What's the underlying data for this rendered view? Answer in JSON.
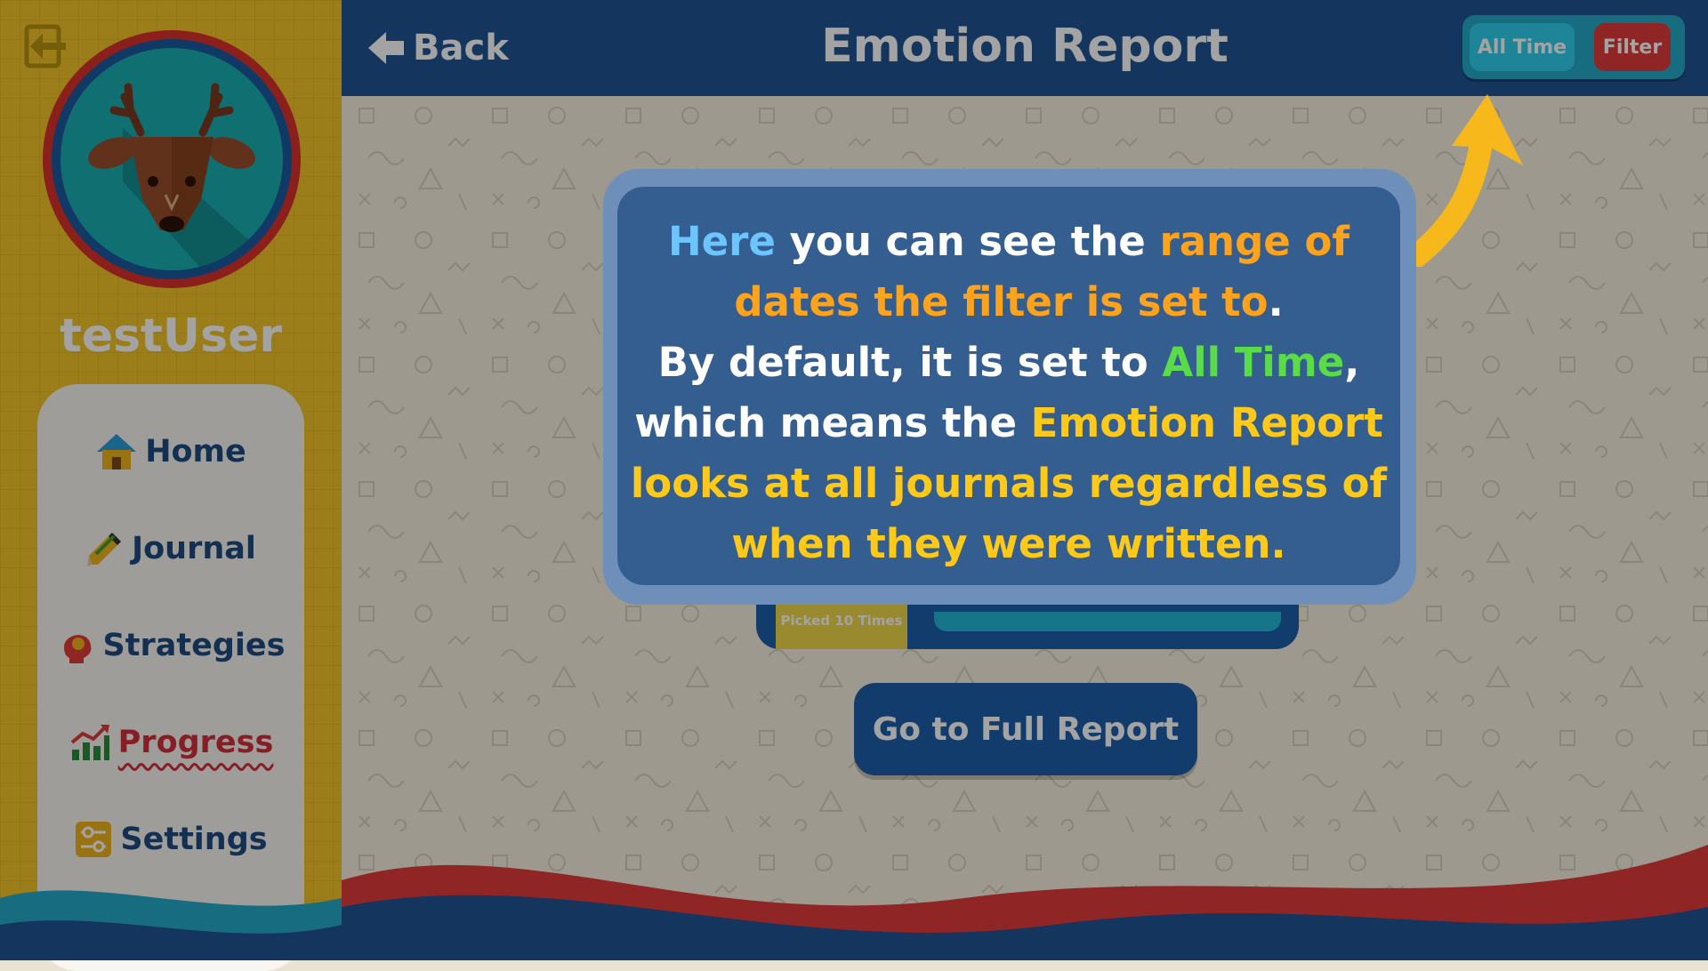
{
  "header": {
    "back_label": "Back",
    "title": "Emotion Report",
    "filter_range_label": "All Time",
    "filter_button_label": "Filter"
  },
  "sidebar": {
    "username": "testUser",
    "avatar": "deer-avatar",
    "items": [
      {
        "label": "Home",
        "icon": "home-icon"
      },
      {
        "label": "Journal",
        "icon": "pencil-icon"
      },
      {
        "label": "Strategies",
        "icon": "head-icon"
      },
      {
        "label": "Progress",
        "icon": "chart-up-icon",
        "active": true
      },
      {
        "label": "Settings",
        "icon": "sliders-icon"
      }
    ]
  },
  "report": {
    "picked_label": "Picked 10 Times",
    "full_report_button": "Go to Full Report"
  },
  "tutorial": {
    "parts": [
      {
        "text": "Here",
        "color": "#6cc5ff"
      },
      {
        "text": " you can see the ",
        "color": "#ffffff"
      },
      {
        "text": "range of dates the filter is set to",
        "color": "#ffa21c"
      },
      {
        "text": ".",
        "color": "#ffffff"
      },
      {
        "text": "By default, it is set to ",
        "color": "#ffffff"
      },
      {
        "text": "All Time",
        "color": "#59dc47"
      },
      {
        "text": ",",
        "color": "#ffffff"
      },
      {
        "text": "which means the ",
        "color": "#ffffff"
      },
      {
        "text": "Emotion Report looks at all journals regardless of when they were written.",
        "color": "#ffc91a"
      }
    ]
  },
  "colors": {
    "header_bg": "#1f5394",
    "sidebar_bg": "#f2c52a",
    "accent_red": "#e23a3a",
    "accent_cyan": "#30d0f0"
  }
}
